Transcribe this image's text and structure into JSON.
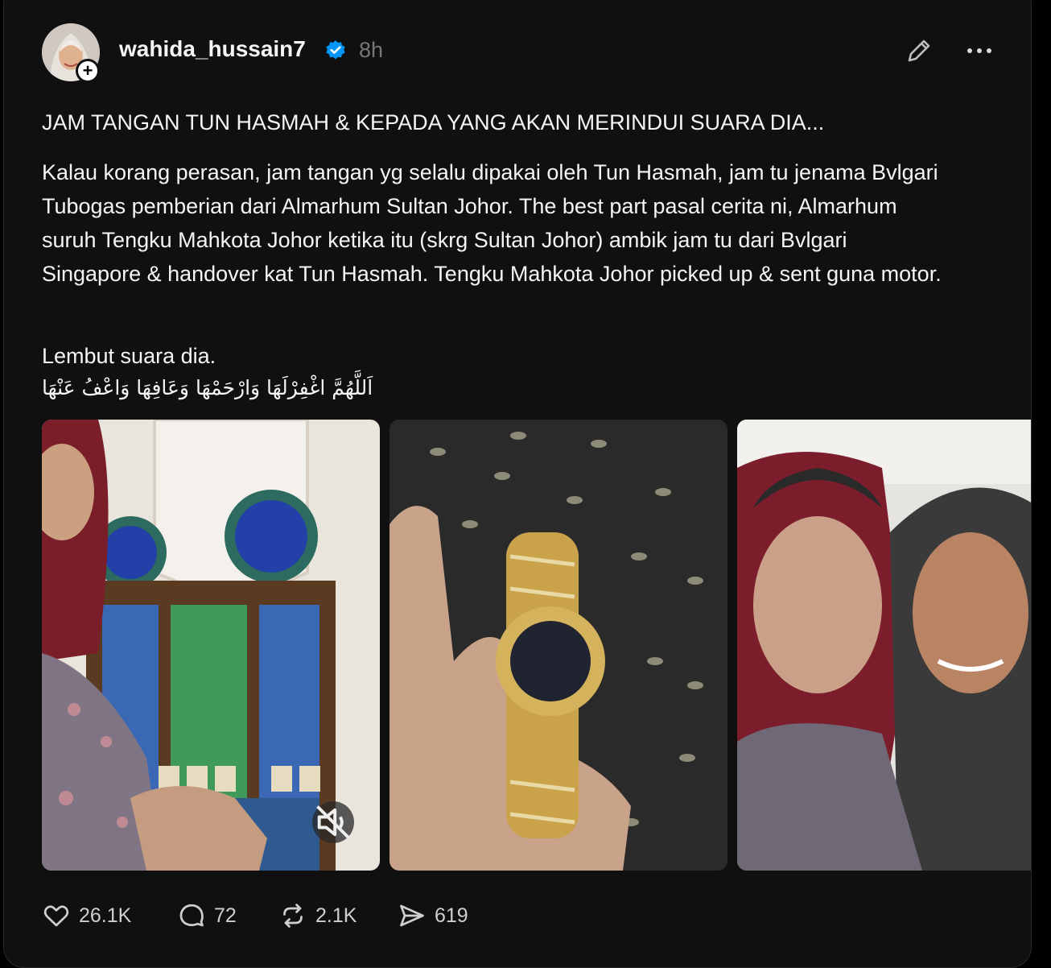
{
  "post": {
    "username": "wahida_hussain7",
    "time": "8h",
    "title": "JAM TANGAN TUN HASMAH & KEPADA YANG AKAN MERINDUI SUARA DIA...",
    "body": "Kalau korang perasan, jam tangan yg selalu dipakai oleh Tun Hasmah, jam tu jenama Bvlgari Tubogas pemberian dari Almarhum Sultan Johor. The best part pasal cerita ni, Almarhum suruh Tengku Mahkota Johor ketika itu (skrg Sultan Johor) ambik jam tu dari Bvlgari Singapore & handover kat Tun Hasmah. Tengku Mahkota Johor picked up & sent guna motor.",
    "line3": "Lembut suara dia.",
    "prayer": "اَللَّهُمَّ اغْفِرْلَهَا وَارْحَمْهَا وَعَافِهَا وَاعْفُ عَنْهَا"
  },
  "icons": {
    "follow": "plus-icon",
    "verified": "verified-badge-icon",
    "edit": "pencil-icon",
    "more": "more-horizontal-icon",
    "mute": "speaker-muted-icon",
    "like": "heart-icon",
    "reply": "comment-icon",
    "repost": "repost-icon",
    "share": "send-icon"
  },
  "actions": {
    "likes": "26.1K",
    "replies": "72",
    "reposts": "2.1K",
    "shares": "619"
  },
  "colors": {
    "background": "#101010",
    "text": "#f3f5f7",
    "muted": "#777777",
    "verified": "#0095f6"
  }
}
